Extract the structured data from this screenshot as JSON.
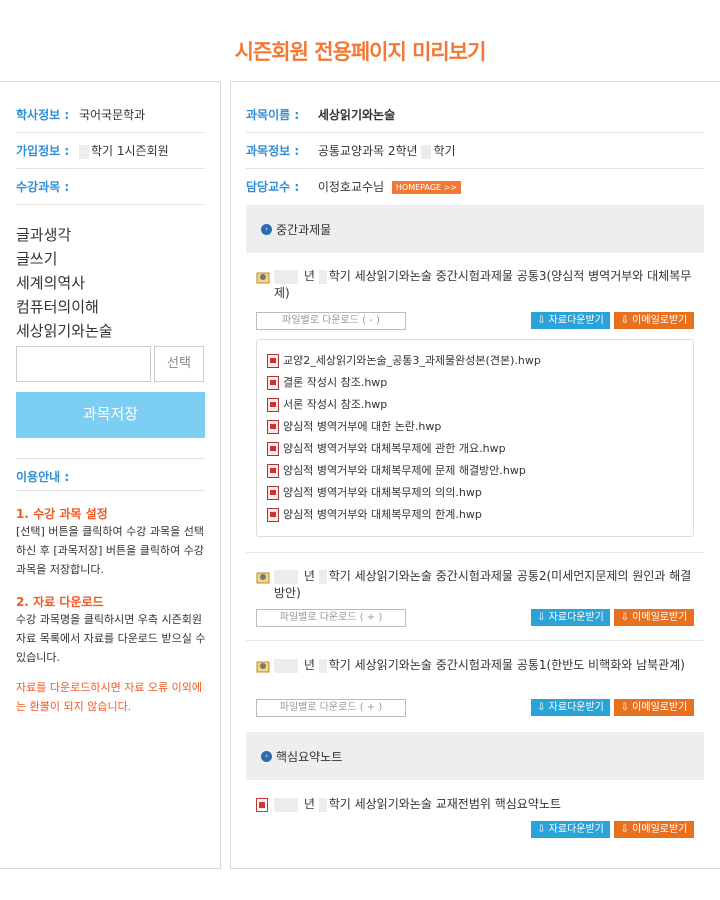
{
  "page_title": "시즌회원 전용페이지 미리보기",
  "left": {
    "academic_label": "학사정보 :",
    "academic_value": "국어국문학과",
    "join_label": "가입정보 :",
    "join_value": "학기 1시즌회원",
    "courses_label": "수강과목 :",
    "courses": [
      "글과생각",
      "글쓰기",
      "세계의역사",
      "컴퓨터의이해",
      "세상읽기와논술"
    ],
    "select_button": "선택",
    "save_button": "과목저장",
    "guide_label": "이용안내 :",
    "guide1_title": "1. 수강 과목 설정",
    "guide1_body": "[선택] 버튼을 클릭하여 수강 과목을 선택하신 후 [과목저장] 버튼을 클릭하여 수강 과목을 저장합니다.",
    "guide2_title": "2. 자료 다운로드",
    "guide2_body": "수강 과목명을 클릭하시면 우측 시즌회원 자료 목록에서 자료를 다운로드 받으실 수 있습니다.",
    "warning": "자료를 다운로드하시면 자료 오류 이외에는 환불이 되지 않습니다."
  },
  "right": {
    "course_name_label": "과목이름 :",
    "course_name": "세상읽기와논술",
    "course_info_label": "과목정보 :",
    "course_info_a": "공통교양과목 2학년",
    "course_info_b": "학기",
    "professor_label": "담당교수 :",
    "professor": "이정호교수님",
    "homepage": "HOMEPAGE >>",
    "section1": "중간과제물",
    "section2": "핵심요약노트",
    "year_suffix": "년",
    "items": [
      {
        "title": "학기 세상읽기와논술 중간시험과제물 공통3(양심적 병역거부와 대체복무제)",
        "file_toggle": "파일별로 다운로드 ( - )",
        "files": [
          "교양2_세상읽기와논술_공통3_과제물완성본(견본).hwp",
          "결론 작성시 참조.hwp",
          "서론 작성시 참조.hwp",
          "양심적 병역거부에 대한 논란.hwp",
          "양심적 병역거부와 대체복무제에 관한 개요.hwp",
          "양심적 병역거부와 대체복무제에 문제 해결방안.hwp",
          "양심적 병역거부와 대체복무제의 의의.hwp",
          "양심적 병역거부와 대체복무제의 한계.hwp"
        ]
      },
      {
        "title": "학기 세상읽기와논술 중간시험과제물 공통2(미세먼지문제의 원인과 해결방안)",
        "file_toggle": "파일별로 다운로드 ( + )"
      },
      {
        "title": "학기 세상읽기와논술 중간시험과제물 공통1(한반도 비핵화와 남북관계)",
        "file_toggle": "파일별로 다운로드 ( + )"
      },
      {
        "title": "학기 세상읽기와논술 교재전범위 핵심요약노트"
      }
    ],
    "download_button": "⇩ 자료다운받기",
    "email_button": "⇩ 이메일로받기"
  }
}
